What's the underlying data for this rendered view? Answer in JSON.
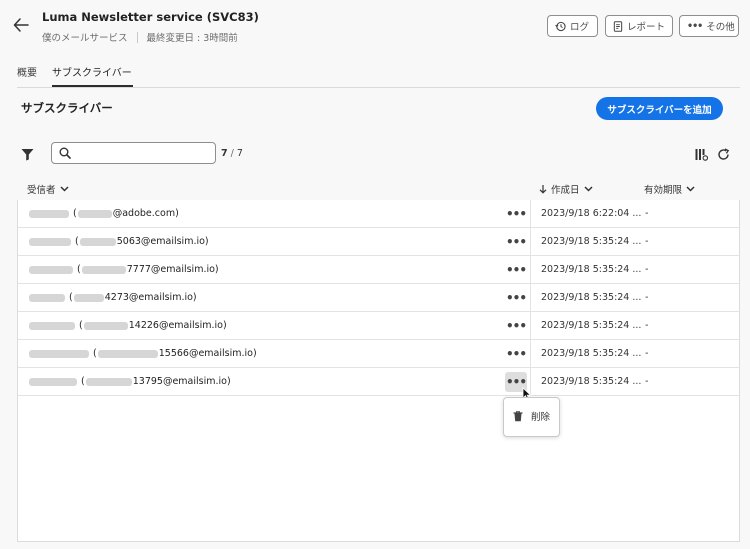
{
  "header": {
    "title": "Luma Newsletter service (SVC83)",
    "subtitle": "僕のメールサービス",
    "last_modified": "最終変更日 : 3時間前",
    "buttons": {
      "log": "ログ",
      "report": "レポート",
      "more": "その他"
    }
  },
  "tabs": [
    {
      "label": "概要",
      "active": false
    },
    {
      "label": "サブスクライバー",
      "active": true
    }
  ],
  "section": {
    "title": "サブスクライバー",
    "add_button": "サブスクライバーを追加"
  },
  "search": {
    "value": "",
    "placeholder": ""
  },
  "count": {
    "shown": "7",
    "total": "7"
  },
  "columns": {
    "recipient": "受信者",
    "created": "作成日",
    "expiry": "有効期限"
  },
  "rows": [
    {
      "email_visible": "@adobe.com",
      "created": "2023/9/18 6:22:04 ...",
      "expiry": "-"
    },
    {
      "email_visible": "5063@emailsim.io)",
      "created": "2023/9/18 5:35:24 ...",
      "expiry": "-"
    },
    {
      "email_visible": "7777@emailsim.io)",
      "created": "2023/9/18 5:35:24 ...",
      "expiry": "-"
    },
    {
      "email_visible": "4273@emailsim.io)",
      "created": "2023/9/18 5:35:24 ...",
      "expiry": "-"
    },
    {
      "email_visible": "14226@emailsim.io)",
      "created": "2023/9/18 5:35:24 ...",
      "expiry": "-"
    },
    {
      "email_visible": "15566@emailsim.io)",
      "created": "2023/9/18 5:35:24 ...",
      "expiry": "-"
    },
    {
      "email_visible": "13795@emailsim.io)",
      "created": "2023/9/18 5:35:24 ...",
      "expiry": "-"
    }
  ],
  "context_menu": {
    "delete_label": "削除"
  },
  "colors": {
    "accent": "#1473e6",
    "text": "#2c2c2c",
    "border": "#dcdcdc",
    "background": "#f8f8f8"
  },
  "icons": {
    "back": "arrow-left-icon",
    "log": "history-icon",
    "report": "report-icon",
    "more": "ellipsis-icon",
    "filter": "filter-icon",
    "search": "search-icon",
    "columns": "column-settings-icon",
    "refresh": "refresh-icon",
    "sort_desc": "arrow-down-icon",
    "chevron": "chevron-down-icon",
    "delete": "trash-icon"
  }
}
